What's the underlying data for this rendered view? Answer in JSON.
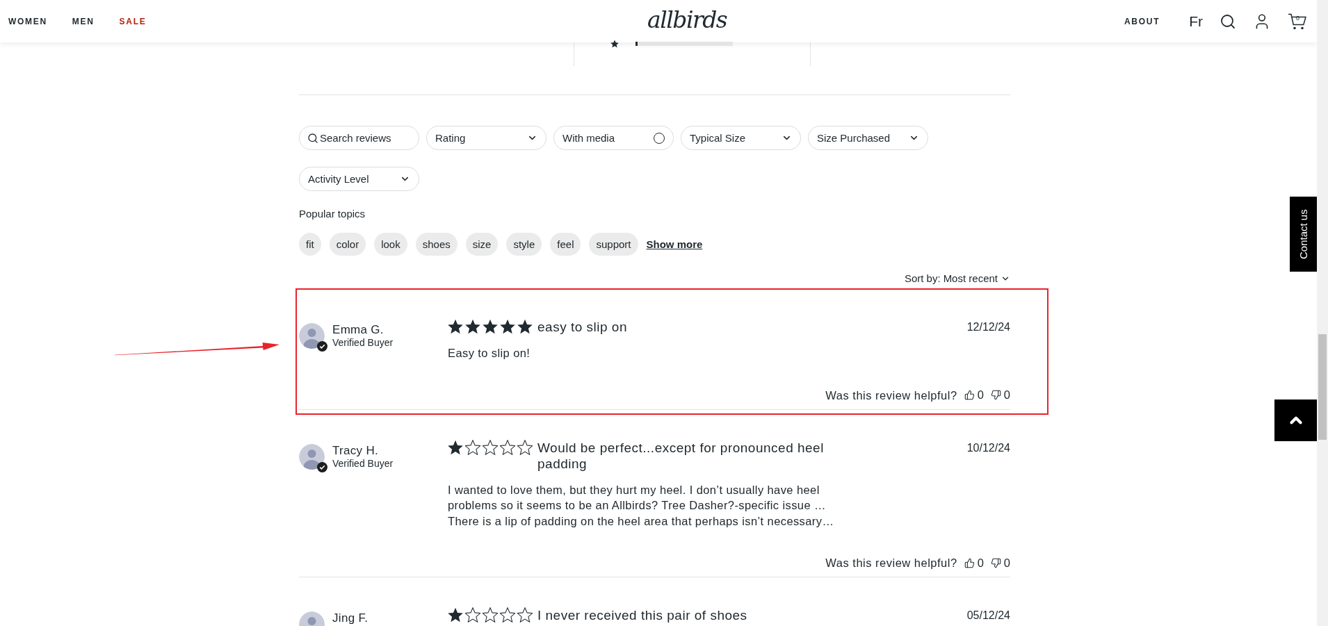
{
  "header": {
    "nav": [
      {
        "label": "WOMEN",
        "kind": "regular"
      },
      {
        "label": "MEN",
        "kind": "regular"
      },
      {
        "label": "SALE",
        "kind": "sale"
      }
    ],
    "logo": "allbirds",
    "links": [
      {
        "label": "ABOUT",
        "kind": "caps"
      },
      {
        "label": "Fr",
        "kind": "language"
      }
    ],
    "cart_count": "0"
  },
  "rating_summary": {
    "rows": [
      {
        "level": 0.02
      }
    ]
  },
  "filters": [
    {
      "kind": "search",
      "placeholder": "Search reviews"
    },
    {
      "kind": "dropdown",
      "label": "Rating"
    },
    {
      "kind": "toggle",
      "label": "With media",
      "checked": false
    },
    {
      "kind": "dropdown",
      "label": "Typical Size"
    },
    {
      "kind": "dropdown",
      "label": "Size Purchased"
    },
    {
      "kind": "dropdown",
      "label": "Activity Level"
    }
  ],
  "popular_topics": {
    "title": "Popular topics",
    "topics": [
      "fit",
      "color",
      "look",
      "shoes",
      "size",
      "style",
      "feel",
      "support"
    ],
    "show_more": "Show more"
  },
  "sort": {
    "label": "Sort by:",
    "value": "Most recent"
  },
  "reviews": [
    {
      "name": "Emma G.",
      "badge": "Verified Buyer",
      "stars": 5,
      "title": "easy to slip on",
      "date": "12/12/24",
      "body": "Easy to slip on!",
      "helpful_prompt": "Was this review helpful?",
      "up_votes": "0",
      "down_votes": "0",
      "highlighted": true
    },
    {
      "name": "Tracy H.",
      "badge": "Verified Buyer",
      "stars": 1,
      "title": "Would be perfect...except for pronounced heel padding",
      "date": "10/12/24",
      "body": "I wanted to love them, but they hurt my heel. I don’t usually have heel problems so it seems to be an Allbirds? Tree Dasher?-specific issue … There is a lip of padding on the heel area that perhaps isn’t necessary…",
      "helpful_prompt": "Was this review helpful?",
      "up_votes": "0",
      "down_votes": "0",
      "highlighted": false
    },
    {
      "name": "Jing F.",
      "stars": 1,
      "title": "I never received this pair of shoes",
      "date": "05/12/24",
      "highlighted": false
    }
  ],
  "side_tab": {
    "label": "Contact us"
  }
}
